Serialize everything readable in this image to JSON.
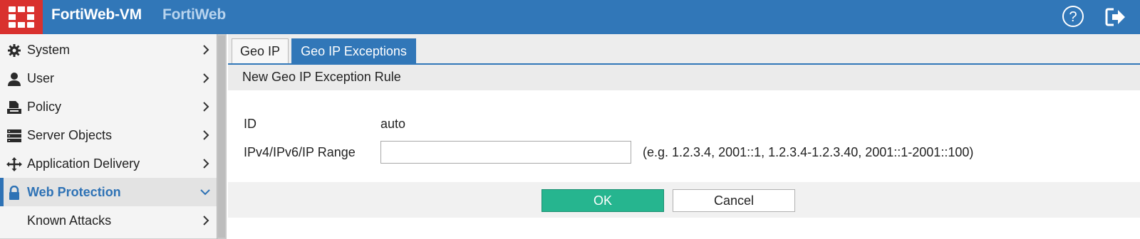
{
  "header": {
    "app_name": "FortiWeb-VM",
    "product": "FortiWeb",
    "logo_icon": "fortinet-logo-icon",
    "help_icon": "help-circle-icon",
    "logout_icon": "logout-icon",
    "bar_color": "#3177b8",
    "logo_color": "#d9312e"
  },
  "sidebar": {
    "items": [
      {
        "label": "System",
        "icon": "gear-icon"
      },
      {
        "label": "User",
        "icon": "user-icon"
      },
      {
        "label": "Policy",
        "icon": "policy-icon"
      },
      {
        "label": "Server Objects",
        "icon": "server-icon"
      },
      {
        "label": "Application Delivery",
        "icon": "move-arrows-icon"
      },
      {
        "label": "Web Protection",
        "icon": "lock-icon",
        "active": true,
        "expanded": true
      },
      {
        "label": "Known Attacks",
        "icon": ""
      }
    ]
  },
  "tabs": [
    {
      "label": "Geo IP",
      "active": false
    },
    {
      "label": "Geo IP Exceptions",
      "active": true
    }
  ],
  "form": {
    "section_title": "New Geo IP Exception Rule",
    "id_label": "ID",
    "id_value": "auto",
    "ip_label": "IPv4/IPv6/IP Range",
    "ip_value": "",
    "ip_hint": "(e.g. 1.2.3.4, 2001::1, 1.2.3.4-1.2.3.40, 2001::1-2001::100)"
  },
  "buttons": {
    "ok": "OK",
    "cancel": "Cancel",
    "ok_color": "#26b58f"
  }
}
